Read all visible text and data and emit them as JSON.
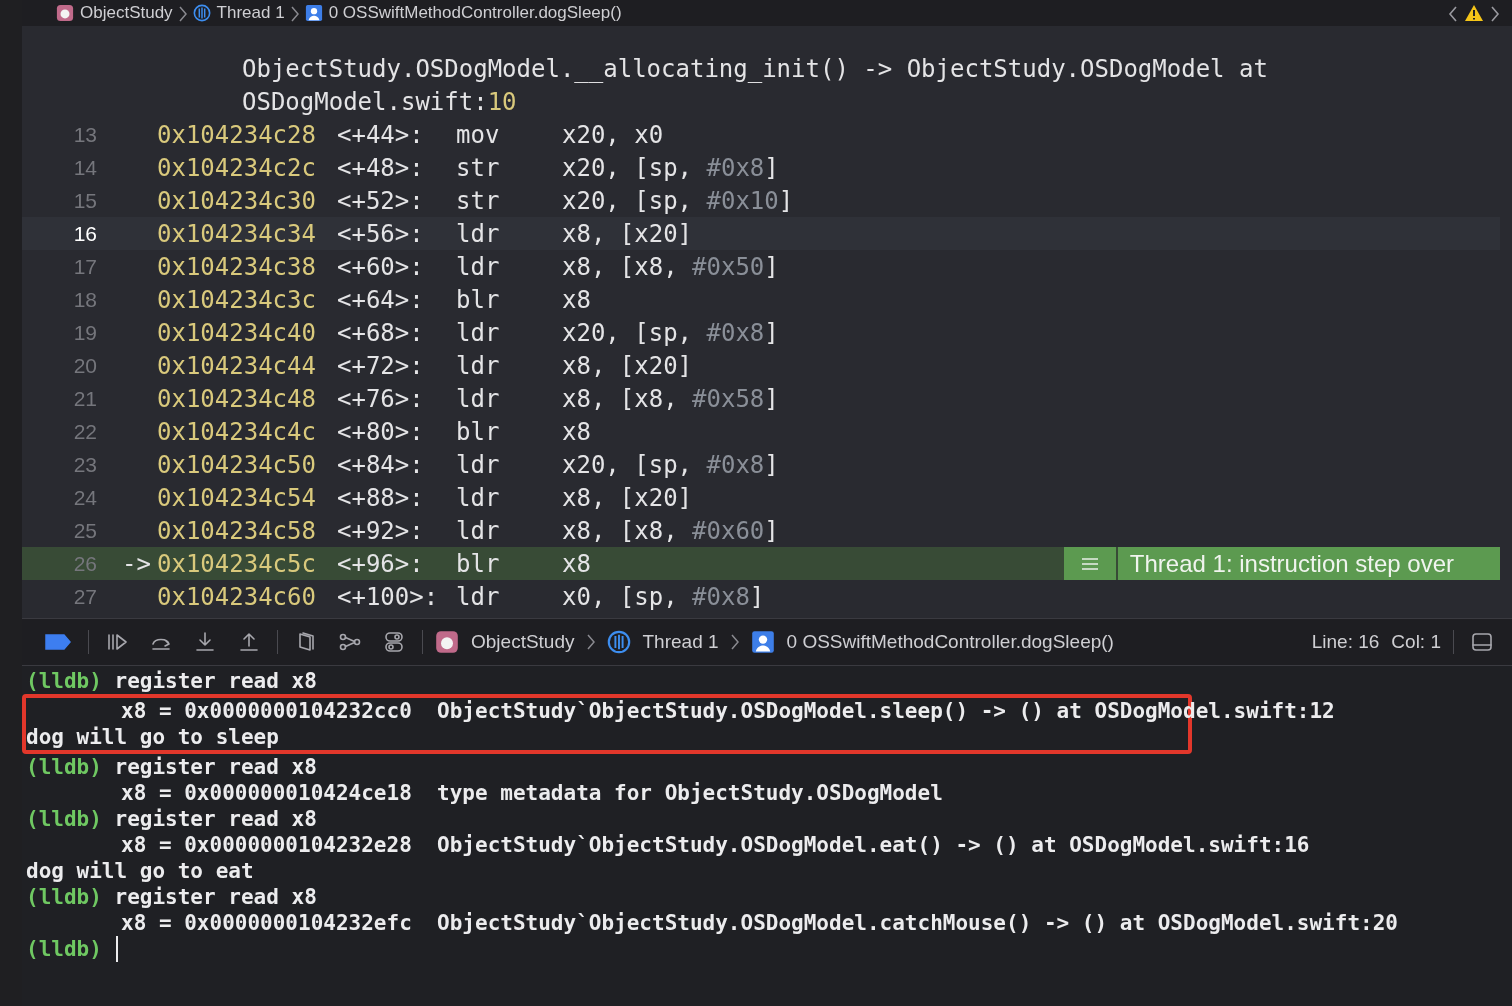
{
  "jump_bar": {
    "items": [
      {
        "kind": "app",
        "label": "ObjectStudy"
      },
      {
        "kind": "thread",
        "label": "Thread 1"
      },
      {
        "kind": "frame",
        "label": "0 OSSwiftMethodController.dogSleep()"
      }
    ]
  },
  "code": {
    "continuation": [
      [
        {
          "kind": "text",
          "text": "ObjectStudy.OSDogModel.__allocating_init() -> ObjectStudy.OSDogModel at"
        }
      ],
      [
        {
          "kind": "text",
          "text": "OSDogModel.swift:"
        },
        {
          "kind": "num",
          "text": "10"
        }
      ]
    ],
    "rows": [
      {
        "line": "13",
        "arrow": "",
        "address": "0x104234c28",
        "offset": "<+44>:",
        "op": "mov",
        "operands": [
          {
            "kind": "text",
            "text": "x20, x0"
          }
        ],
        "current": false,
        "pc": false
      },
      {
        "line": "14",
        "arrow": "",
        "address": "0x104234c2c",
        "offset": "<+48>:",
        "op": "str",
        "operands": [
          {
            "kind": "text",
            "text": "x20, [sp, "
          },
          {
            "kind": "imm",
            "text": "#0x8"
          },
          {
            "kind": "text",
            "text": "]"
          }
        ],
        "current": false,
        "pc": false
      },
      {
        "line": "15",
        "arrow": "",
        "address": "0x104234c30",
        "offset": "<+52>:",
        "op": "str",
        "operands": [
          {
            "kind": "text",
            "text": "x20, [sp, "
          },
          {
            "kind": "imm",
            "text": "#0x10"
          },
          {
            "kind": "text",
            "text": "]"
          }
        ],
        "current": false,
        "pc": false
      },
      {
        "line": "16",
        "arrow": "",
        "address": "0x104234c34",
        "offset": "<+56>:",
        "op": "ldr",
        "operands": [
          {
            "kind": "text",
            "text": "x8, [x20]"
          }
        ],
        "current": true,
        "pc": false
      },
      {
        "line": "17",
        "arrow": "",
        "address": "0x104234c38",
        "offset": "<+60>:",
        "op": "ldr",
        "operands": [
          {
            "kind": "text",
            "text": "x8, [x8, "
          },
          {
            "kind": "imm",
            "text": "#0x50"
          },
          {
            "kind": "text",
            "text": "]"
          }
        ],
        "current": false,
        "pc": false
      },
      {
        "line": "18",
        "arrow": "",
        "address": "0x104234c3c",
        "offset": "<+64>:",
        "op": "blr",
        "operands": [
          {
            "kind": "text",
            "text": "x8"
          }
        ],
        "current": false,
        "pc": false
      },
      {
        "line": "19",
        "arrow": "",
        "address": "0x104234c40",
        "offset": "<+68>:",
        "op": "ldr",
        "operands": [
          {
            "kind": "text",
            "text": "x20, [sp, "
          },
          {
            "kind": "imm",
            "text": "#0x8"
          },
          {
            "kind": "text",
            "text": "]"
          }
        ],
        "current": false,
        "pc": false
      },
      {
        "line": "20",
        "arrow": "",
        "address": "0x104234c44",
        "offset": "<+72>:",
        "op": "ldr",
        "operands": [
          {
            "kind": "text",
            "text": "x8, [x20]"
          }
        ],
        "current": false,
        "pc": false
      },
      {
        "line": "21",
        "arrow": "",
        "address": "0x104234c48",
        "offset": "<+76>:",
        "op": "ldr",
        "operands": [
          {
            "kind": "text",
            "text": "x8, [x8, "
          },
          {
            "kind": "imm",
            "text": "#0x58"
          },
          {
            "kind": "text",
            "text": "]"
          }
        ],
        "current": false,
        "pc": false
      },
      {
        "line": "22",
        "arrow": "",
        "address": "0x104234c4c",
        "offset": "<+80>:",
        "op": "blr",
        "operands": [
          {
            "kind": "text",
            "text": "x8"
          }
        ],
        "current": false,
        "pc": false
      },
      {
        "line": "23",
        "arrow": "",
        "address": "0x104234c50",
        "offset": "<+84>:",
        "op": "ldr",
        "operands": [
          {
            "kind": "text",
            "text": "x20, [sp, "
          },
          {
            "kind": "imm",
            "text": "#0x8"
          },
          {
            "kind": "text",
            "text": "]"
          }
        ],
        "current": false,
        "pc": false
      },
      {
        "line": "24",
        "arrow": "",
        "address": "0x104234c54",
        "offset": "<+88>:",
        "op": "ldr",
        "operands": [
          {
            "kind": "text",
            "text": "x8, [x20]"
          }
        ],
        "current": false,
        "pc": false
      },
      {
        "line": "25",
        "arrow": "",
        "address": "0x104234c58",
        "offset": "<+92>:",
        "op": "ldr",
        "operands": [
          {
            "kind": "text",
            "text": "x8, [x8, "
          },
          {
            "kind": "imm",
            "text": "#0x60"
          },
          {
            "kind": "text",
            "text": "]"
          }
        ],
        "current": false,
        "pc": false
      },
      {
        "line": "26",
        "arrow": "->",
        "address": "0x104234c5c",
        "offset": "<+96>:",
        "op": "blr",
        "operands": [
          {
            "kind": "text",
            "text": "x8"
          }
        ],
        "current": false,
        "pc": true,
        "annotation": "Thread 1: instruction step over"
      },
      {
        "line": "27",
        "arrow": "",
        "address": "0x104234c60",
        "offset": "<+100>:",
        "op": "ldr",
        "operands": [
          {
            "kind": "text",
            "text": "x0, [sp, "
          },
          {
            "kind": "imm",
            "text": "#0x8"
          },
          {
            "kind": "text",
            "text": "]"
          }
        ],
        "current": false,
        "pc": false
      }
    ]
  },
  "debug_bar": {
    "breakpoints_active": true,
    "path": [
      {
        "kind": "app",
        "label": "ObjectStudy"
      },
      {
        "kind": "thread",
        "label": "Thread 1"
      },
      {
        "kind": "frame",
        "label": "0 OSSwiftMethodController.dogSleep()"
      }
    ],
    "line": "Line: 16",
    "col": "Col: 1"
  },
  "console": {
    "lines": [
      {
        "kind": "prompt",
        "prompt": "(lldb)",
        "text": "register read x8"
      },
      {
        "kind": "output",
        "text": "x8 = 0x0000000104232cc0  ObjectStudy`ObjectStudy.OSDogModel.sleep() -> () at OSDogModel.swift:12",
        "boxed": true
      },
      {
        "kind": "program",
        "text": "dog will go to sleep",
        "boxed": true
      },
      {
        "kind": "prompt",
        "prompt": "(lldb)",
        "text": "register read x8"
      },
      {
        "kind": "output",
        "text": "x8 = 0x000000010424ce18  type metadata for ObjectStudy.OSDogModel"
      },
      {
        "kind": "prompt",
        "prompt": "(lldb)",
        "text": "register read x8"
      },
      {
        "kind": "output",
        "text": "x8 = 0x0000000104232e28  ObjectStudy`ObjectStudy.OSDogModel.eat() -> () at OSDogModel.swift:16"
      },
      {
        "kind": "program",
        "text": "dog will go to eat"
      },
      {
        "kind": "prompt",
        "prompt": "(lldb)",
        "text": "register read x8"
      },
      {
        "kind": "output",
        "text": "x8 = 0x0000000104232efc  ObjectStudy`ObjectStudy.OSDogModel.catchMouse() -> () at OSDogModel.swift:20"
      },
      {
        "kind": "prompt",
        "prompt": "(lldb)",
        "cursor": true
      }
    ]
  }
}
